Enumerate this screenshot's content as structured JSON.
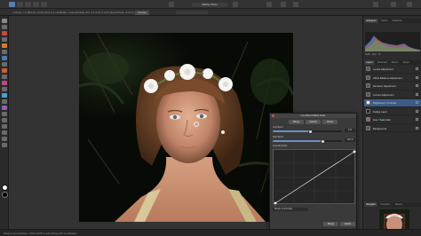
{
  "app": {
    "document_title": "Affinity Photo",
    "toolbar_text": "1 Photo  > 2 48%  Ps 12.00 (W-d.ref, LB/RGBA, ColourProfile) ICC 3.1 (GT)  C 12.5 (Final Photo, 8-bit C)  Layer Strips"
  },
  "toolbar": {
    "button_primary": "Curves",
    "button_secondary": "Zoom"
  },
  "panel": {
    "top_tabs": [
      "Histogram",
      "Colour",
      "Swatches"
    ],
    "histogram_labels": [
      "RGB",
      "Raw",
      "Fit"
    ],
    "layer_tabs": [
      "Layers",
      "Channels",
      "Effects",
      "Styles"
    ],
    "layers": [
      {
        "name": "Levels Adjustment"
      },
      {
        "name": "White Balance Adjustment"
      },
      {
        "name": "Recolour Adjustment"
      },
      {
        "name": "Curves Adjustment"
      },
      {
        "name": "Brightness / Contrast"
      },
      {
        "name": "Dodge Layer"
      },
      {
        "name": "Hue / Saturation"
      },
      {
        "name": "Background"
      }
    ],
    "bottom_tabs": [
      "Navigator",
      "Transform",
      "History"
    ]
  },
  "dialog": {
    "title": "Live Blend Mask Node",
    "buttons": [
      "Merge",
      "Opacity",
      "Reset"
    ],
    "label_1": "Low Bend",
    "value_1": "0 %",
    "slider_1": 0.55,
    "label_2": "High Bend",
    "value_2": "100 %",
    "slider_2": 0.72,
    "label_3": "Intensity Ratio",
    "select_label": "Master Composite",
    "footer_buttons": [
      "Merge",
      "Delete"
    ]
  },
  "status": {
    "text": "Drag to set selection. Click+Shift to add. Drag+Ctrl to subtract."
  }
}
